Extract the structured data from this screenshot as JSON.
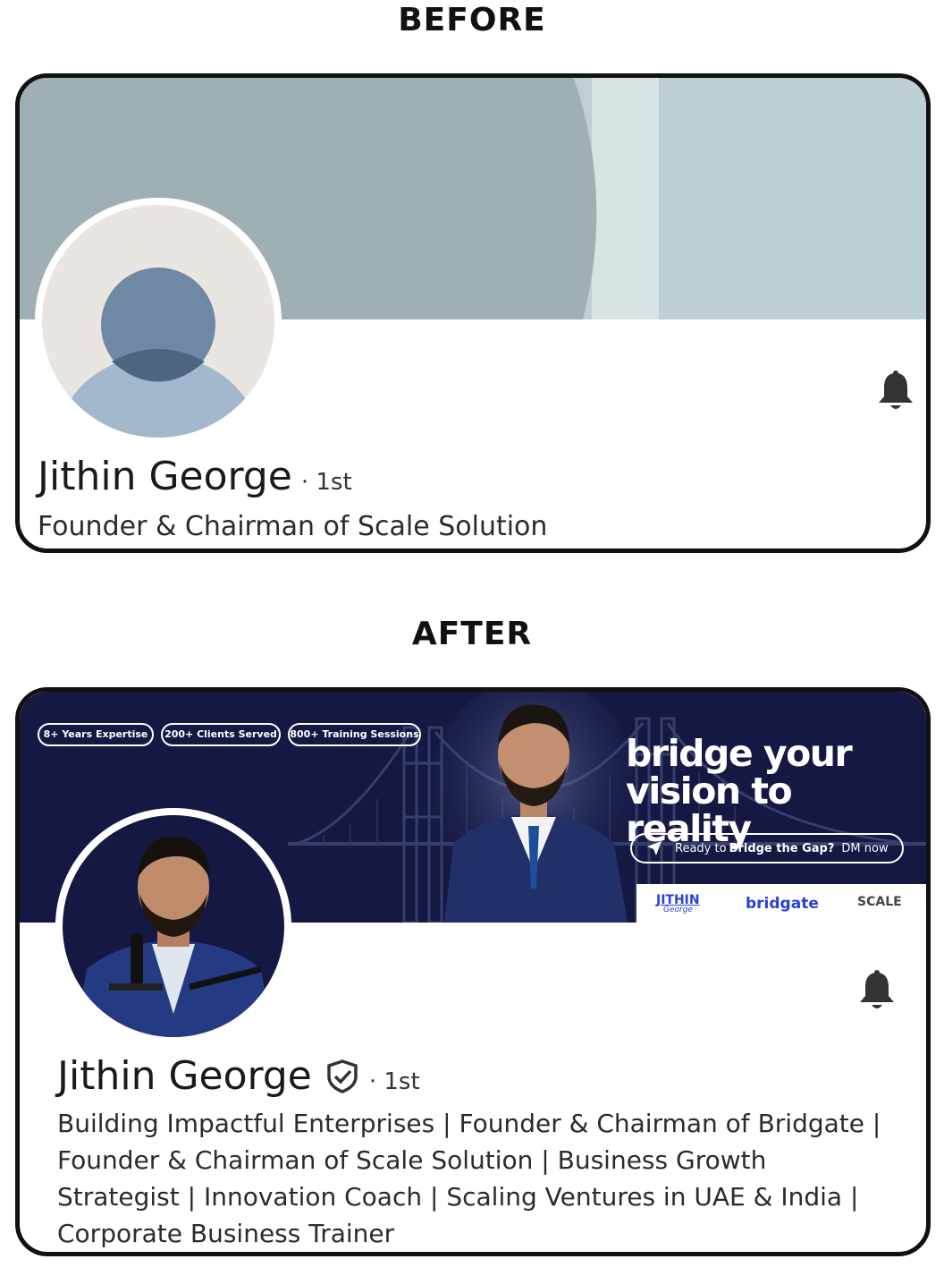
{
  "before": {
    "heading": "BEFORE",
    "profile": {
      "name": "Jithin George",
      "degree": "· 1st",
      "headline": "Founder & Chairman of Scale Solution"
    },
    "icons": {
      "bell": "bell-icon",
      "avatar": "default-avatar-placeholder"
    },
    "colors": {
      "banner": "#9fb0b4",
      "banner_light": "#d8e3e5",
      "banner_right": "#bdd0d4",
      "avatar_bg": "#e9e5e0"
    }
  },
  "after": {
    "heading": "AFTER",
    "banner": {
      "pills": [
        "8+ Years Expertise",
        "200+ Clients Served",
        "800+ Training Sessions"
      ],
      "tagline_line1": "bridge your",
      "tagline_line2": "vision to reality",
      "cta_prefix": "Ready to ",
      "cta_bold": "Bridge the Gap?",
      "cta_suffix": "DM now",
      "logos": {
        "jithin": "JITHIN",
        "jithin_script": "George",
        "bridgate": "bridgate",
        "scale": "SCALE"
      }
    },
    "profile": {
      "name": "Jithin George",
      "degree": "· 1st",
      "headline_lines": [
        "Building Impactful Enterprises | Founder & Chairman of Bridgate |",
        "Founder & Chairman of Scale Solution | Business Growth",
        "Strategist | Innovation Coach | Scaling Ventures in UAE & India |",
        "Corporate Business Trainer"
      ]
    },
    "icons": {
      "bell": "bell-icon",
      "verified": "verified-shield-icon",
      "send": "send-icon",
      "bridge": "bridge-illustration"
    },
    "colors": {
      "banner": "#141843",
      "accent_logo": "#2a3fd8"
    }
  }
}
